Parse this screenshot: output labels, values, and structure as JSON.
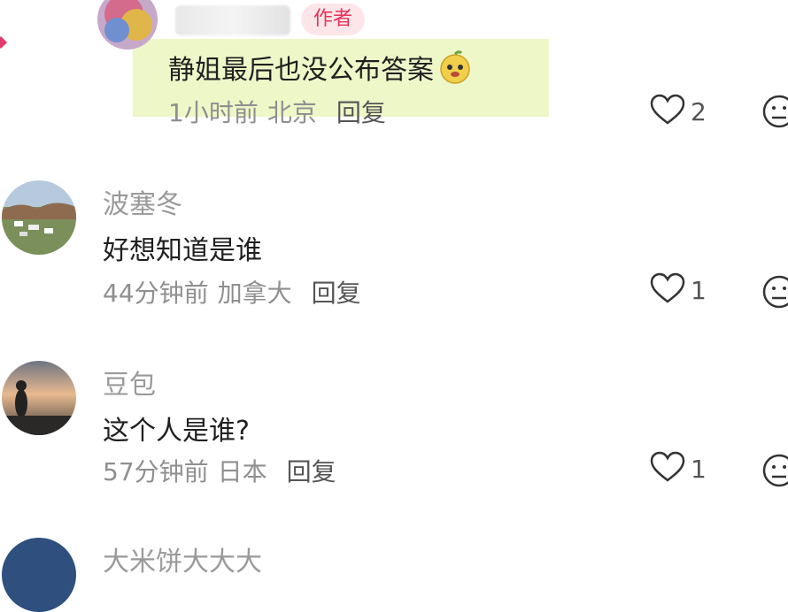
{
  "comments": [
    {
      "username": "",
      "badge": "作者",
      "text": "静姐最后也没公布答案",
      "time": "1小时前",
      "location": "北京",
      "reply_label": "回复",
      "likes": "2"
    },
    {
      "username": "波塞冬",
      "text": "好想知道是谁",
      "time": "44分钟前",
      "location": "加拿大",
      "reply_label": "回复",
      "likes": "1"
    },
    {
      "username": "豆包",
      "text": "这个人是谁?",
      "time": "57分钟前",
      "location": "日本",
      "reply_label": "回复",
      "likes": "1"
    },
    {
      "username": "大米饼大大大"
    }
  ],
  "icons": {
    "like": "heart-outline-icon",
    "dislike": "sad-face-icon",
    "emoji": "yellow-emoji-icon"
  },
  "colors": {
    "highlight": "#eef7c8",
    "badge_bg": "#fde6ea",
    "badge_text": "#e5325a",
    "meta": "#8f8f8f"
  }
}
